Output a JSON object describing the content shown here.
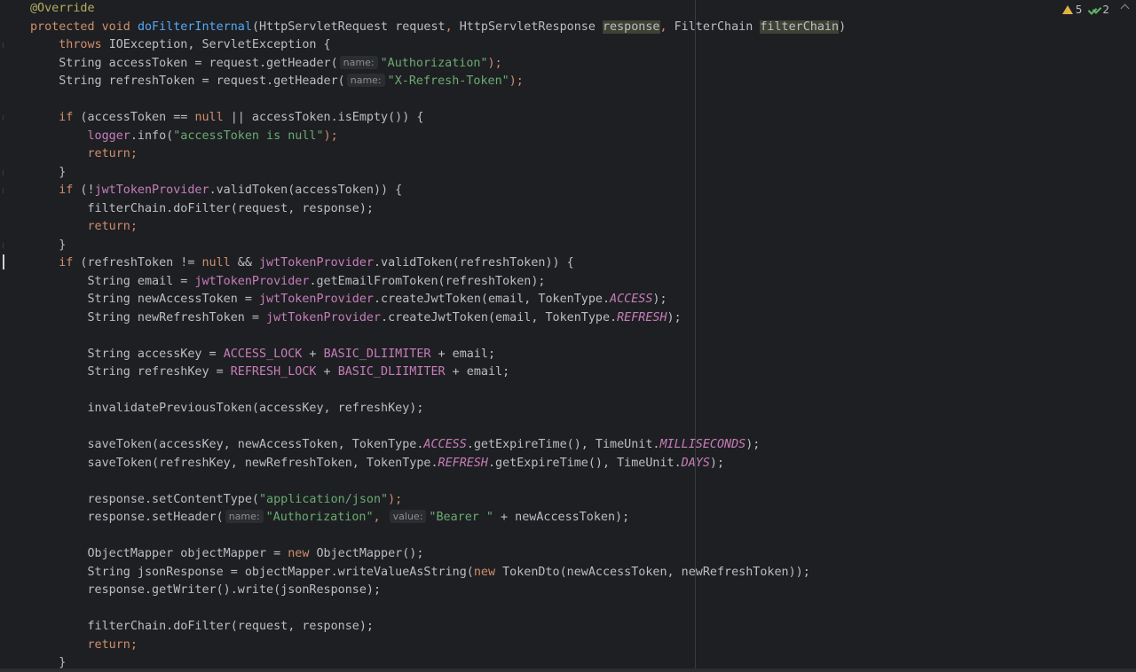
{
  "editor": {
    "colors": {
      "background": "#1e1f22",
      "keyword": "#cf8e6d",
      "annotation": "#b3ae60",
      "method": "#56a8f5",
      "string": "#6aab73",
      "field": "#c77dbb",
      "text": "#bcbec4"
    },
    "inspections": {
      "warnings_count": "5",
      "weak_warnings_count": "2",
      "warning_icon": "warning-triangle-icon",
      "weak_warning_icon": "double-check-icon"
    }
  },
  "code": {
    "l1": {
      "ann": "@Override"
    },
    "l2": {
      "kw_protected": "protected",
      "kw_void": "void",
      "method_name": "doFilterInternal",
      "p1_type": "HttpServletRequest",
      "p1_name": "request",
      "p2_type": "HttpServletResponse",
      "p2_name": "response",
      "p3_type": "FilterChain",
      "p3_name": "filterChain"
    },
    "l3": {
      "kw_throws": "throws",
      "exceptions": "IOException, ServletException {"
    },
    "l4": {
      "decl": "String accessToken = request.getHeader(",
      "hint": "name:",
      "str": "\"Authorization\"",
      "end": ");"
    },
    "l5": {
      "decl": "String refreshToken = request.getHeader(",
      "hint": "name:",
      "str": "\"X-Refresh-Token\"",
      "end": ");"
    },
    "l7": {
      "kw_if": "if",
      "a": " (accessToken == ",
      "kw_null": "null",
      "b": " || accessToken.isEmpty()) {"
    },
    "l8": {
      "fld": "logger",
      "a": ".info(",
      "str": "\"accessToken is null\"",
      "end": ");"
    },
    "l9": {
      "kw_return": "return",
      "end": ";"
    },
    "l10": {
      "brace": "}"
    },
    "l11": {
      "kw_if": "if",
      "a": " (!",
      "fld": "jwtTokenProvider",
      "b": ".validToken(accessToken)) {"
    },
    "l12": {
      "a": "filterChain.doFilter(request, response);"
    },
    "l13": {
      "kw_return": "return",
      "end": ";"
    },
    "l14": {
      "brace": "}"
    },
    "l15": {
      "kw_if": "if",
      "a": " (refreshToken != ",
      "kw_null": "null",
      "b": " && ",
      "fld": "jwtTokenProvider",
      "c": ".validToken(refreshToken)) {"
    },
    "l16": {
      "a": "String email = ",
      "fld": "jwtTokenProvider",
      "b": ".getEmailFromToken(refreshToken);"
    },
    "l17": {
      "a": "String newAccessToken = ",
      "fld": "jwtTokenProvider",
      "b": ".createJwtToken(email, TokenType.",
      "it": "ACCESS",
      "end": ");"
    },
    "l18": {
      "a": "String newRefreshToken = ",
      "fld": "jwtTokenProvider",
      "b": ".createJwtToken(email, TokenType.",
      "it": "REFRESH",
      "end": ");"
    },
    "l20": {
      "a": "String accessKey = ",
      "f1": "ACCESS_LOCK",
      "b": " + ",
      "f2": "BASIC_DLIIMITER",
      "c": " + email;"
    },
    "l21": {
      "a": "String refreshKey = ",
      "f1": "REFRESH_LOCK",
      "b": " + ",
      "f2": "BASIC_DLIIMITER",
      "c": " + email;"
    },
    "l23": {
      "a": "invalidatePreviousToken(accessKey, refreshKey);"
    },
    "l25": {
      "a": "saveToken(accessKey, newAccessToken, TokenType.",
      "it1": "ACCESS",
      "b": ".getExpireTime(), TimeUnit.",
      "it2": "MILLISECONDS",
      "end": ");"
    },
    "l26": {
      "a": "saveToken(refreshKey, newRefreshToken, TokenType.",
      "it1": "REFRESH",
      "b": ".getExpireTime(), TimeUnit.",
      "it2": "DAYS",
      "end": ");"
    },
    "l28": {
      "a": "response.setContentType(",
      "str": "\"application/json\"",
      "end": ");"
    },
    "l29": {
      "a": "response.setHeader(",
      "hint1": "name:",
      "str1": "\"Authorization\"",
      "b": ", ",
      "hint2": "value:",
      "str2": "\"Bearer \"",
      "c": " + newAccessToken);"
    },
    "l31": {
      "a": "ObjectMapper objectMapper = ",
      "kw_new": "new",
      "b": " ObjectMapper();"
    },
    "l32": {
      "a": "String jsonResponse = objectMapper.writeValueAsString(",
      "kw_new": "new",
      "b": " TokenDto(newAccessToken, newRefreshToken));"
    },
    "l33": {
      "a": "response.getWriter().write(jsonResponse);"
    },
    "l35": {
      "a": "filterChain.doFilter(request, response);"
    },
    "l36": {
      "kw_return": "return",
      "end": ";"
    },
    "l37": {
      "brace": "}"
    }
  }
}
